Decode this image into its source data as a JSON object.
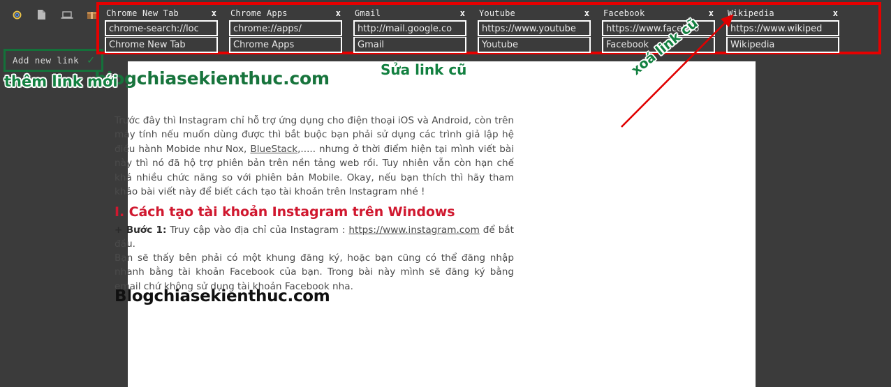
{
  "toolbar": {
    "icons": [
      {
        "name": "chrome-ring-icon",
        "glyph": "◉"
      },
      {
        "name": "page-document-icon",
        "glyph": "▯"
      },
      {
        "name": "laptop-icon",
        "glyph": "▭"
      },
      {
        "name": "package-box-icon",
        "glyph": "▣"
      }
    ]
  },
  "add_link": {
    "label": "Add new link",
    "check": "✓"
  },
  "links": {
    "close_glyph": "x",
    "cards": [
      {
        "title": "Chrome New Tab",
        "url": "chrome-search://loc",
        "name": "Chrome New Tab"
      },
      {
        "title": "Chrome Apps",
        "url": "chrome://apps/",
        "name": "Chrome Apps"
      },
      {
        "title": "Gmail",
        "url": "http://mail.google.co",
        "name": "Gmail"
      },
      {
        "title": "Youtube",
        "url": "https://www.youtube",
        "name": "Youtube"
      },
      {
        "title": "Facebook",
        "url": "https://www.faceboo",
        "name": "Facebook"
      },
      {
        "title": "Wikipedia",
        "url": "https://www.wikiped",
        "name": "Wikipedia"
      }
    ]
  },
  "annotations": {
    "add": "thêm link mới",
    "edit": "Sửa link cũ",
    "delete": "xoá link cũ"
  },
  "page": {
    "blog_title": "blogchiasekienthuc.com",
    "paragraph1_a": "Trước đây thì Instagram chỉ hỗ trợ ứng dụng cho điện thoại iOS và Android, còn trên máy tính nếu muốn dùng được thì bắt buộc bạn phải sử dụng các trình giả lập hệ điều hành Mobide như Nox, ",
    "paragraph1_link": "BlueStack",
    "paragraph1_b": ",..... nhưng ở thời điểm hiện tại mình viết bài này thì nó đã hộ trợ phiên bản trên nền tảng web rồi. Tuy nhiên vẫn còn hạn chế khá nhiều chức năng so với phiên bản Mobile. Okay, nếu bạn thích thì hãy tham khảo bài viết này để biết cách tạo tài khoản trên Instagram nhé !",
    "section_heading": "I. Cách tạo tài khoản Instagram trên Windows",
    "step_label": "+ Bước 1:",
    "step_text_a": " Truy cập vào địa chỉ của Instagram : ",
    "step_link": "https://www.instagram.com",
    "step_text_b": " để bắt đầu.",
    "paragraph2": "Bạn sẽ thấy bên phải có một khung đăng ký, hoặc bạn cũng có thể đăng nhập nhanh bằng tài khoản Facebook của bạn. Trong bài này mình sẽ đăng ký bằng email chứ không sử dụng tài khoản Facebook nha.",
    "watermark": "Blogchiasekienthuc.com"
  },
  "colors": {
    "highlight_red": "#e60000",
    "annotation_green": "#128040",
    "blog_green": "#17743c",
    "heading_red": "#d0182f",
    "panel_bg": "#3b3b3b"
  }
}
